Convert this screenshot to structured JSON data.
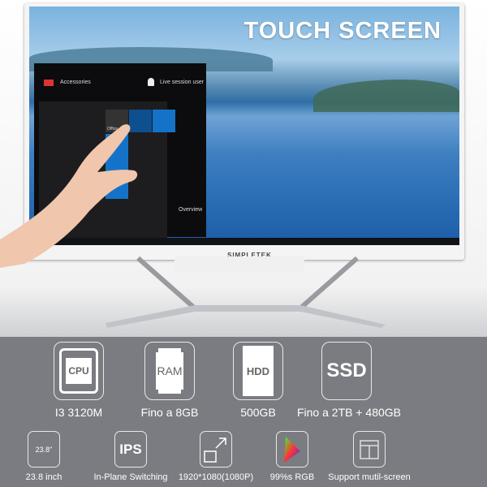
{
  "banner": {
    "title": "TOUCH SCREEN"
  },
  "screen": {
    "start_menu": {
      "accessories": "Accessories",
      "user": "Live session user",
      "office_tile": "Office",
      "overview": "Overview"
    }
  },
  "brand": "SIMPLETEK",
  "specs": {
    "main": [
      {
        "icon": "cpu-icon",
        "icon_text": "CPU",
        "label": "I3 3120M"
      },
      {
        "icon": "ram-icon",
        "icon_text": "RAM",
        "label": "Fino a 8GB"
      },
      {
        "icon": "hdd-icon",
        "icon_text": "HDD",
        "label": "500GB"
      },
      {
        "icon": "ssd-icon",
        "icon_text": "SSD",
        "label": "Fino a 2TB + 480GB"
      }
    ],
    "secondary": [
      {
        "icon": "screen-size-icon",
        "icon_text": "23.8\"",
        "label": "23.8 inch"
      },
      {
        "icon": "ips-icon",
        "icon_text": "IPS",
        "label": "In-Plane Switching"
      },
      {
        "icon": "resolution-icon",
        "label": "1920*1080(1080P)"
      },
      {
        "icon": "color-gamut-icon",
        "label": "99%s RGB"
      },
      {
        "icon": "multi-screen-icon",
        "label": "Support mutil-screen"
      }
    ]
  },
  "colors": {
    "panel": "#7b7c82",
    "screen_blue": "#2f6ea6"
  }
}
